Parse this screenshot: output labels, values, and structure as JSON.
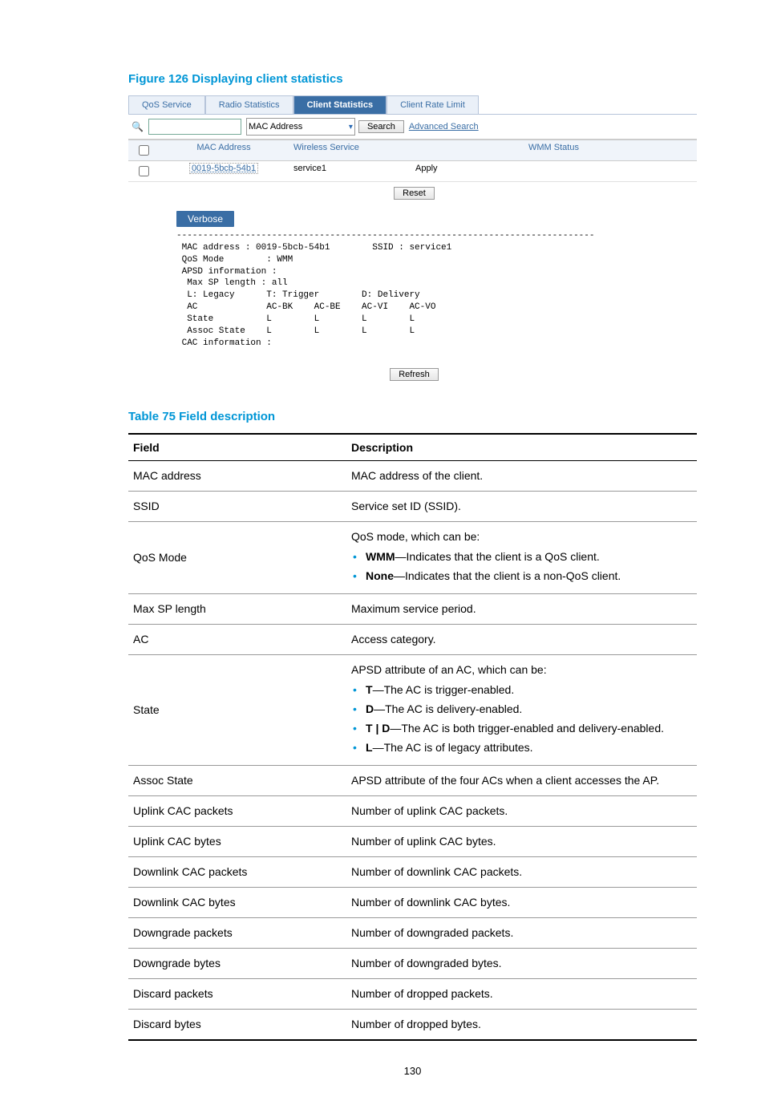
{
  "figure_title": "Figure 126 Displaying client statistics",
  "tabs": {
    "qos": "QoS Service",
    "radio": "Radio Statistics",
    "client": "Client Statistics",
    "rate": "Client Rate Limit"
  },
  "search": {
    "field_select": "MAC Address",
    "button": "Search",
    "advanced": "Advanced Search"
  },
  "columns": {
    "mac": "MAC Address",
    "wireless": "Wireless Service",
    "wmm": "WMM Status"
  },
  "row": {
    "mac": "0019-5bcb-54b1",
    "service": "service1",
    "wmm": "Apply"
  },
  "buttons": {
    "reset": "Reset",
    "refresh": "Refresh"
  },
  "verbose_tab": "Verbose",
  "mono": "-------------------------------------------------------------------------------\n MAC address : 0019-5bcb-54b1        SSID : service1\n QoS Mode        : WMM\n APSD information :\n  Max SP length : all\n  L: Legacy      T: Trigger        D: Delivery\n  AC             AC-BK    AC-BE    AC-VI    AC-VO\n  State          L        L        L        L\n  Assoc State    L        L        L        L\n CAC information :",
  "table_title": "Table 75 Field description",
  "th_field": "Field",
  "th_desc": "Description",
  "rows": {
    "r1": {
      "f": "MAC address",
      "d": "MAC address of the client."
    },
    "r2": {
      "f": "SSID",
      "d": "Service set ID (SSID)."
    },
    "r3": {
      "f": "QoS Mode",
      "lead": "QoS mode, which can be:",
      "b1a": "WMM",
      "b1b": "—Indicates that the client is a QoS client.",
      "b2a": "None",
      "b2b": "—Indicates that the client is a non-QoS client."
    },
    "r4": {
      "f": "Max SP length",
      "d": "Maximum service period."
    },
    "r5": {
      "f": "AC",
      "d": "Access category."
    },
    "r6": {
      "f": "State",
      "lead": "APSD attribute of an AC, which can be:",
      "b1a": "T",
      "b1b": "—The AC is trigger-enabled.",
      "b2a": "D",
      "b2b": "—The AC is delivery-enabled.",
      "b3a": "T | D",
      "b3b": "—The AC is both trigger-enabled and delivery-enabled.",
      "b4a": "L",
      "b4b": "—The AC is of legacy attributes."
    },
    "r7": {
      "f": "Assoc State",
      "d": "APSD attribute of the four ACs when a client accesses the AP."
    },
    "r8": {
      "f": "Uplink CAC packets",
      "d": "Number of uplink CAC packets."
    },
    "r9": {
      "f": "Uplink CAC bytes",
      "d": "Number of uplink CAC bytes."
    },
    "r10": {
      "f": "Downlink CAC packets",
      "d": "Number of downlink CAC packets."
    },
    "r11": {
      "f": "Downlink CAC bytes",
      "d": "Number of downlink CAC bytes."
    },
    "r12": {
      "f": "Downgrade packets",
      "d": "Number of downgraded packets."
    },
    "r13": {
      "f": "Downgrade bytes",
      "d": "Number of downgraded bytes."
    },
    "r14": {
      "f": "Discard packets",
      "d": "Number of dropped packets."
    },
    "r15": {
      "f": "Discard bytes",
      "d": "Number of dropped bytes."
    }
  },
  "page_number": "130"
}
